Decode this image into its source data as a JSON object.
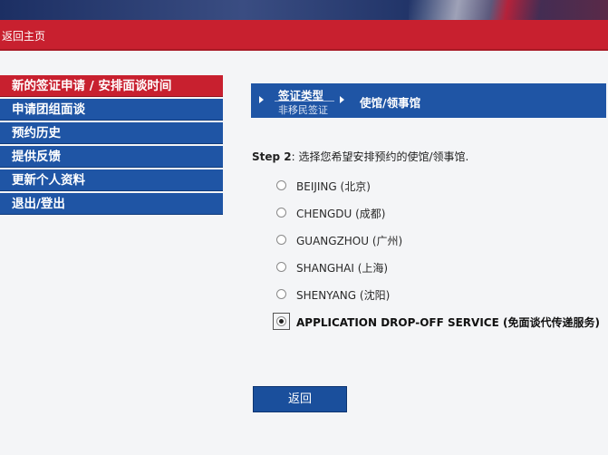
{
  "header": {
    "home_link": "返回主页"
  },
  "sidebar": {
    "items": [
      {
        "label": "新的签证申请 / 安排面谈时间",
        "active": true
      },
      {
        "label": "申请团组面谈"
      },
      {
        "label": "预约历史"
      },
      {
        "label": "提供反馈"
      },
      {
        "label": "更新个人资料"
      },
      {
        "label": "退出/登出"
      }
    ]
  },
  "steps": {
    "step1": {
      "title": "签证类型",
      "subtitle": "非移民签证"
    },
    "step2": {
      "title": "使馆/领事馆"
    }
  },
  "main": {
    "step_label": "Step 2",
    "instruction": ": 选择您希望安排预约的使馆/领事馆.",
    "options": [
      {
        "label": "BEIJING (北京)",
        "selected": false
      },
      {
        "label": "CHENGDU (成都)",
        "selected": false
      },
      {
        "label": "GUANGZHOU (广州)",
        "selected": false
      },
      {
        "label": "SHANGHAI (上海)",
        "selected": false
      },
      {
        "label": "SHENYANG (沈阳)",
        "selected": false
      },
      {
        "label": "APPLICATION DROP-OFF SERVICE (免面谈代传递服务)",
        "selected": true
      }
    ],
    "back_button": "返回"
  },
  "colors": {
    "red": "#c8202f",
    "blue": "#1f55a5",
    "background": "#f4f5f7"
  }
}
